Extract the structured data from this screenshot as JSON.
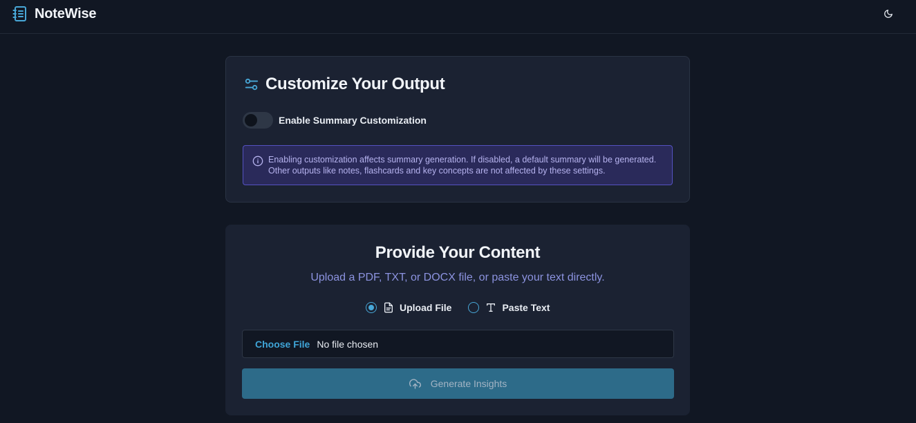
{
  "header": {
    "app_name": "NoteWise"
  },
  "customize": {
    "title": "Customize Your Output",
    "toggle_label": "Enable Summary Customization",
    "toggle_enabled": false,
    "info": "Enabling customization affects summary generation. If disabled, a default summary will be generated. Other outputs like notes, flashcards and key concepts are not affected by these settings."
  },
  "content": {
    "title": "Provide Your Content",
    "subtitle": "Upload a PDF, TXT, or DOCX file, or paste your text directly.",
    "options": [
      {
        "label": "Upload File",
        "selected": true,
        "icon": "file-icon"
      },
      {
        "label": "Paste Text",
        "selected": false,
        "icon": "text-icon"
      }
    ],
    "file_input": {
      "button_label": "Choose File",
      "status": "No file chosen"
    },
    "generate_label": "Generate Insights"
  },
  "colors": {
    "accent": "#48a8d8",
    "background": "#111723",
    "card": "#1b2232",
    "info_bg": "#2a2a5a",
    "button": "#2d6b89"
  }
}
